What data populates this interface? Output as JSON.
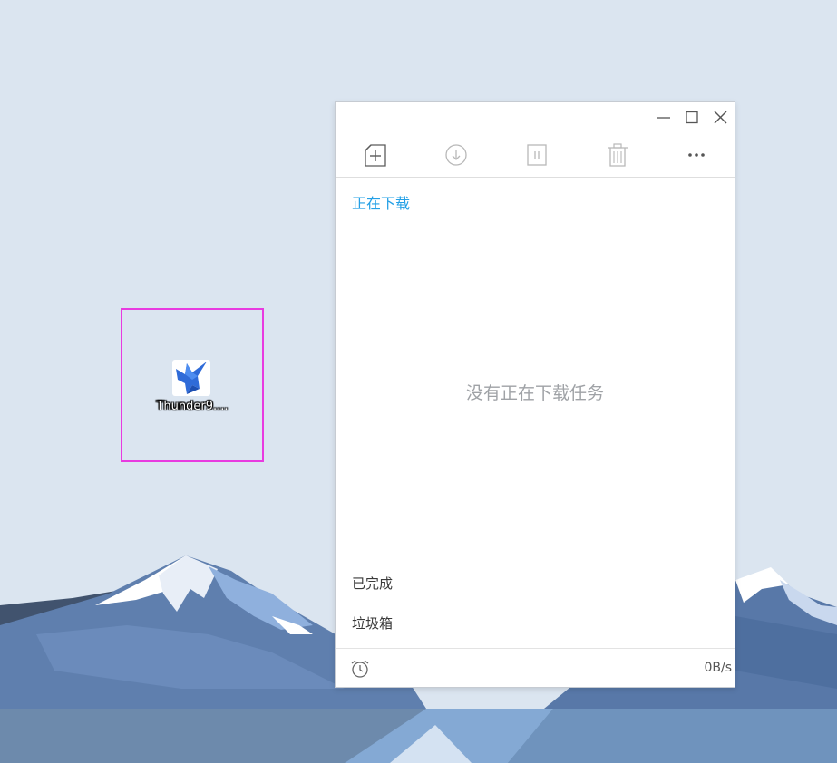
{
  "desktop": {
    "icon": {
      "name": "bird-logo-icon",
      "label": "Thunder9....",
      "highlight_color": "#e83be0"
    }
  },
  "window": {
    "controls": {
      "minimize": "minimize-icon",
      "maximize": "maximize-icon",
      "close": "close-icon"
    },
    "toolbar": [
      {
        "name": "new-task-icon"
      },
      {
        "name": "download-icon"
      },
      {
        "name": "pause-icon"
      },
      {
        "name": "trash-icon"
      },
      {
        "name": "more-icon"
      }
    ],
    "tabs": {
      "downloading": "正在下载",
      "completed": "已完成",
      "trash": "垃圾箱"
    },
    "empty_message": "没有正在下载任务",
    "footer": {
      "alarm_icon": "alarm-clock-icon",
      "speed": "0B/s"
    }
  },
  "colors": {
    "accent": "#23a0e6",
    "desktop_bg": "#dbe5f0"
  }
}
